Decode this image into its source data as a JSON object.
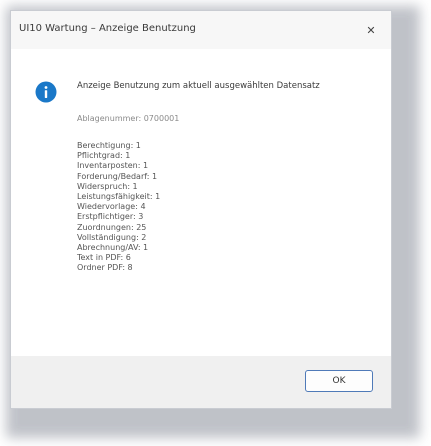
{
  "window": {
    "title": "UI10 Wartung – Anzeige Benutzung",
    "close_glyph": "✕"
  },
  "message": {
    "icon": "info-icon",
    "icon_color": "#1a78c8",
    "text": "Anzeige Benutzung zum aktuell ausgewählten Datensatz",
    "record": "Ablagenummer: 0700001"
  },
  "details": [
    "Berechtigung: 1",
    "Pflichtgrad: 1",
    "Inventarposten: 1",
    "Forderung/Bedarf: 1",
    "Widerspruch: 1",
    "Leistungsfähigkeit: 1",
    "Wiedervorlage: 4",
    "Erstpflichtiger: 3",
    "Zuordnungen: 25",
    "Vollständigung: 2",
    "Abrechnung/AV: 1",
    "Text in PDF: 6",
    "Ordner PDF: 8"
  ],
  "buttons": {
    "ok_label": "OK"
  },
  "colors": {
    "accent": "#1a78c8",
    "button_border": "#4f7ab8"
  }
}
